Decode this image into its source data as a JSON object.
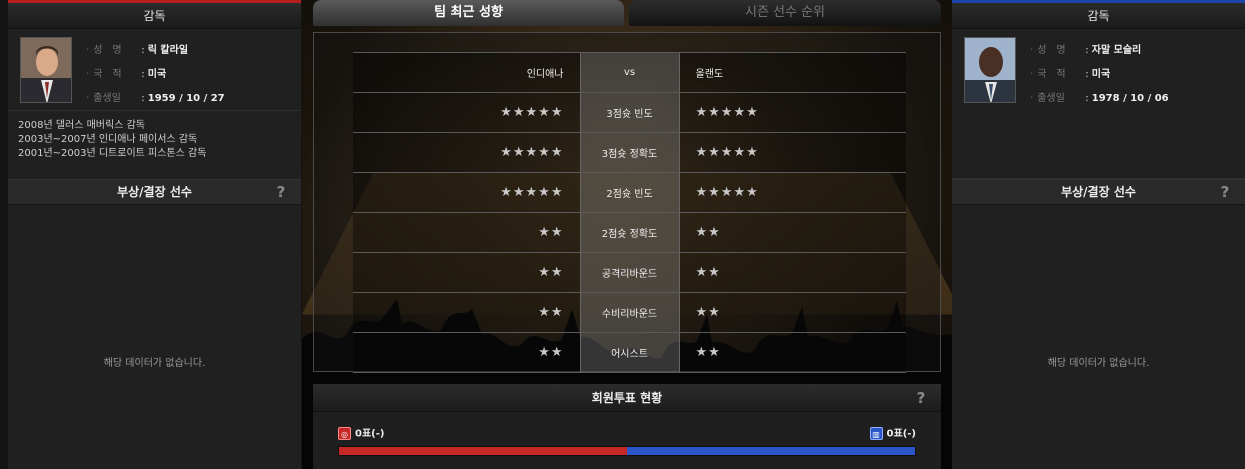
{
  "tabs": {
    "active": "팀 최근 성향",
    "inactive": "시즌 선수 순위"
  },
  "left": {
    "header": "감독",
    "labels": {
      "name": "성　명",
      "nation": "국　적",
      "birth": "출생일"
    },
    "coach": {
      "name": "릭 칼라일",
      "nation": "미국",
      "birth": "1959 / 10 / 27"
    },
    "career": [
      "2008년 댈러스 매버릭스 감독",
      "2003년~2007년 인디애나 페이서스 감독",
      "2001년~2003년 디트로이트 피스톤스 감독"
    ],
    "injury_header": "부상/결장 선수",
    "nodata": "해당 데이터가 없습니다.",
    "accent": "#b31e1e"
  },
  "right": {
    "header": "감독",
    "labels": {
      "name": "성　명",
      "nation": "국　적",
      "birth": "출생일"
    },
    "coach": {
      "name": "자말 모슬리",
      "nation": "미국",
      "birth": "1978 / 10 / 06"
    },
    "injury_header": "부상/결장 선수",
    "nodata": "해당 데이터가 없습니다.",
    "accent": "#1d44a8"
  },
  "help_glyph": "?",
  "comparison": {
    "home_team": "인디애나",
    "vs": "vs",
    "away_team": "올랜도",
    "rows": [
      {
        "label": "3점슛 빈도",
        "home": "★★★★★",
        "away": "★★★★★"
      },
      {
        "label": "3점슛 정확도",
        "home": "★★★★★",
        "away": "★★★★★"
      },
      {
        "label": "2점슛 빈도",
        "home": "★★★★★",
        "away": "★★★★★"
      },
      {
        "label": "2점슛 정확도",
        "home": "★★",
        "away": "★★"
      },
      {
        "label": "공격리바운드",
        "home": "★★",
        "away": "★★"
      },
      {
        "label": "수비리바운드",
        "home": "★★",
        "away": "★★"
      },
      {
        "label": "어시스트",
        "home": "★★",
        "away": "★★"
      }
    ]
  },
  "vote": {
    "title": "회원투표 현황",
    "left_text": "0표(-)",
    "right_text": "0표(-)",
    "left_share": 0.5,
    "right_share": 0.5,
    "left_color": "#c62828",
    "right_color": "#2b56c8"
  }
}
